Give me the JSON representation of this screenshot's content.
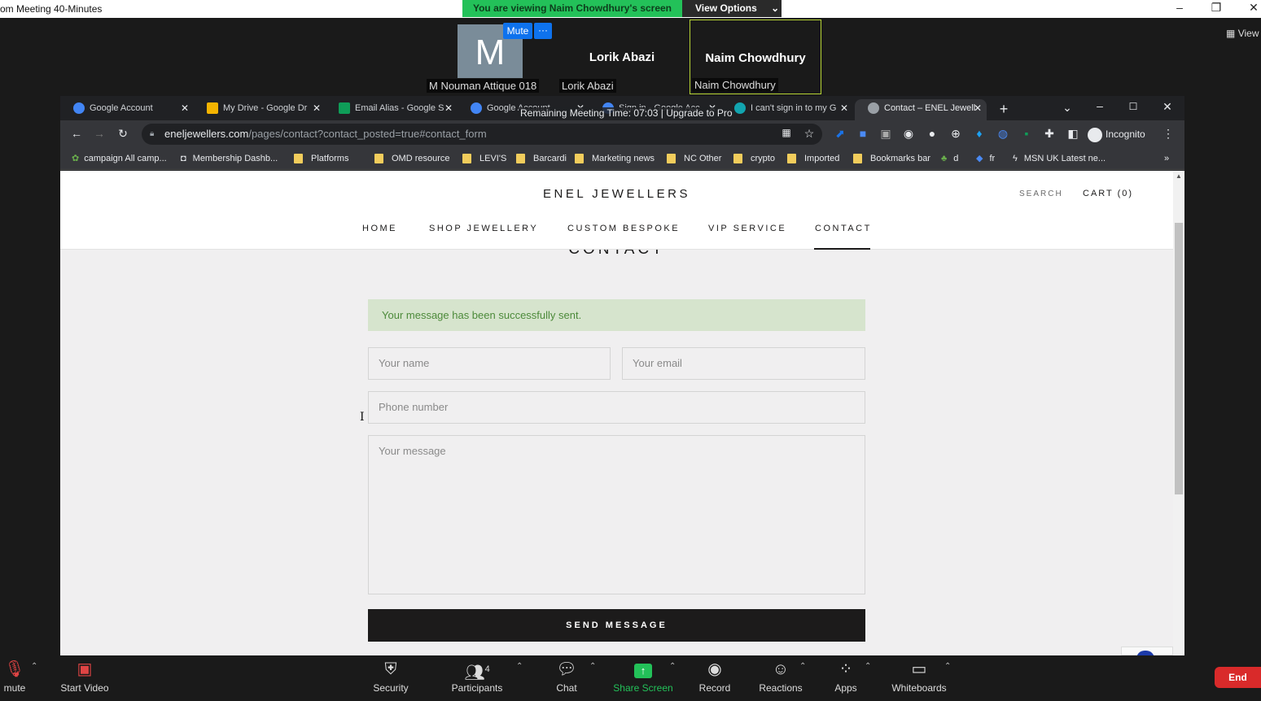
{
  "zoom": {
    "window_title": "om Meeting 40-Minutes",
    "viewing_banner": "You are viewing Naim Chowdhury's screen",
    "view_options": "View Options",
    "view_right": "View",
    "participants": [
      {
        "initial": "M",
        "label": "M Nouman Attique 018"
      },
      {
        "name": "Lorik Abazi",
        "label": "Lorik Abazi"
      },
      {
        "name": "Naim Chowdhury",
        "label": "Naim Chowdhury"
      }
    ],
    "mute_label": "Mute",
    "more_label": "···",
    "remaining": "Remaining Meeting Time: 07:03 | Upgrade to Pro",
    "toolbar": {
      "unmute": "mute",
      "start_video": "Start Video",
      "security": "Security",
      "participants": "Participants",
      "participants_count": "4",
      "chat": "Chat",
      "share_screen": "Share Screen",
      "record": "Record",
      "reactions": "Reactions",
      "apps": "Apps",
      "whiteboards": "Whiteboards",
      "end": "End"
    },
    "colors": {
      "banner": "#23c159",
      "end": "#d92a2a",
      "share": "#23c159",
      "mute_button": "#0e72ed"
    }
  },
  "browser": {
    "tabs": [
      {
        "title": "Google Account",
        "icon_color": "#e8eaed"
      },
      {
        "title": "My Drive - Google Dr",
        "icon_color": "#f4b400"
      },
      {
        "title": "Email Alias - Google S",
        "icon_color": "#0f9d58"
      },
      {
        "title": "Google Account",
        "icon_color": "#e8eaed"
      },
      {
        "title": "Sign in - Google Acc",
        "icon_color": "#e8eaed"
      },
      {
        "title": "I can't sign in to my G",
        "icon_color": "#12a4af"
      },
      {
        "title": "Contact – ENEL Jewell",
        "icon_color": "#e8eaed"
      }
    ],
    "url_host": "eneljewellers.com",
    "url_path": "/pages/contact?contact_posted=true#contact_form",
    "incognito": "Incognito",
    "bookmarks": [
      "campaign All camp...",
      "Membership Dashb...",
      "Platforms",
      "OMD resource",
      "LEVI'S",
      "Barcardi",
      "Marketing news",
      "NC Other",
      "crypto",
      "Imported",
      "Bookmarks bar",
      "d",
      "fr",
      "MSN UK  Latest ne..."
    ],
    "bookmarks_more": "»"
  },
  "site": {
    "brand": "ENEL JEWELLERS",
    "search": "SEARCH",
    "cart": "CART (0)",
    "nav": [
      "HOME",
      "SHOP JEWELLERY",
      "CUSTOM BESPOKE",
      "VIP SERVICE",
      "CONTACT"
    ],
    "page_title": "CONTACT",
    "success_message": "Your message has been successfully sent.",
    "form": {
      "name_placeholder": "Your name",
      "email_placeholder": "Your email",
      "phone_placeholder": "Phone number",
      "message_placeholder": "Your message",
      "submit": "SEND MESSAGE"
    }
  }
}
